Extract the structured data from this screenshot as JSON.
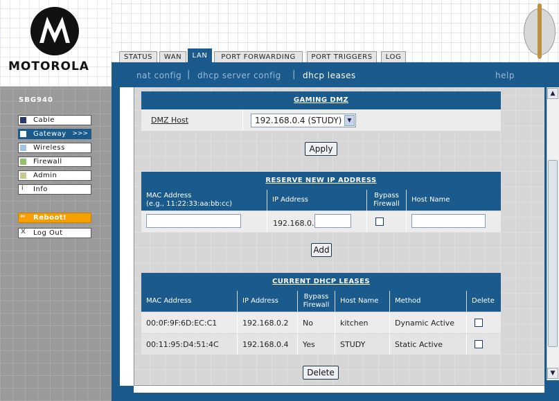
{
  "brand": {
    "name": "MOTOROLA",
    "model": "SBG940"
  },
  "tabs": [
    "STATUS",
    "WAN",
    "LAN",
    "PORT FORWARDING",
    "PORT TRIGGERS",
    "LOG"
  ],
  "subnav": {
    "nat": "nat config",
    "dhcp_server": "dhcp server config",
    "dhcp_leases": "dhcp leases",
    "help": "help"
  },
  "sidebar": {
    "items": [
      {
        "label": "Cable",
        "color": "#2b3a6b"
      },
      {
        "label": "Gateway",
        "color": "#ffffff",
        "arrow": ">>>"
      },
      {
        "label": "Wireless",
        "color": "#9fc3e6"
      },
      {
        "label": "Firewall",
        "color": "#8fc26a"
      },
      {
        "label": "Admin",
        "color": "#c8c890"
      },
      {
        "label": "Info",
        "glyph": "i"
      }
    ],
    "reboot": {
      "label": "Reboot!",
      "glyph": "⇦"
    },
    "logout": {
      "label": "Log Out",
      "glyph": "X"
    }
  },
  "dmz": {
    "title": "GAMING DMZ",
    "host_label": "DMZ Host",
    "host_value": "192.168.0.4 (STUDY)",
    "apply": "Apply"
  },
  "reserve": {
    "title": "RESERVE NEW IP ADDRESS",
    "col_mac": "MAC Address",
    "col_mac_hint": "(e.g., 11:22:33:aa:bb:cc)",
    "col_ip": "IP Address",
    "col_bypass": "Bypass",
    "col_bypass2": "Firewall",
    "col_host": "Host Name",
    "ip_prefix": "192.168.0.",
    "add": "Add"
  },
  "leases": {
    "title": "CURRENT DHCP LEASES",
    "headers": {
      "mac": "MAC Address",
      "ip": "IP Address",
      "bypass": "Bypass",
      "bypass2": "Firewall",
      "host": "Host Name",
      "method": "Method",
      "delete": "Delete"
    },
    "rows": [
      {
        "mac": "00:0F:9F:6D:EC:C1",
        "ip": "192.168.0.2",
        "bypass": "No",
        "host": "kitchen",
        "method": "Dynamic Active"
      },
      {
        "mac": "00:11:95:D4:51:4C",
        "ip": "192.168.0.4",
        "bypass": "Yes",
        "host": "STUDY",
        "method": "Static Active"
      }
    ],
    "delete_button": "Delete"
  },
  "colors": {
    "accent": "#1a5a8c",
    "reboot": "#f5a000"
  }
}
